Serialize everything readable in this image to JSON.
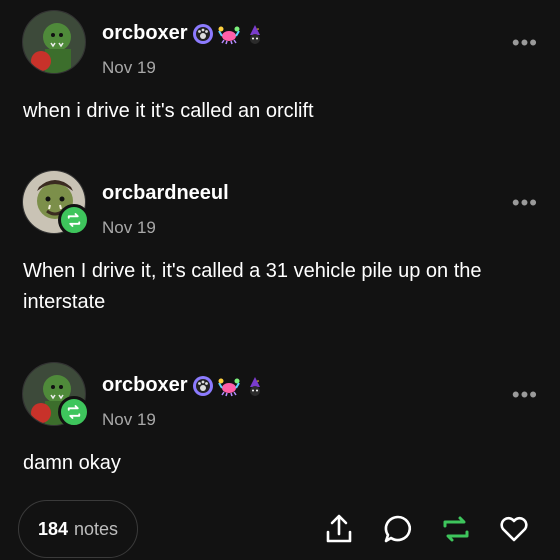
{
  "posts": [
    {
      "username": "orcboxer",
      "date": "Nov 19",
      "text": "when i drive it it's called an orclift",
      "badges": [
        "paw-icon",
        "crab-icon",
        "wizard-icon"
      ],
      "reblogged": false
    },
    {
      "username": "orcbardneeul",
      "date": "Nov 19",
      "text": "When I drive it, it's called a 31 vehicle pile up on the interstate",
      "badges": [],
      "reblogged": true
    },
    {
      "username": "orcboxer",
      "date": "Nov 19",
      "text": "damn okay",
      "badges": [
        "paw-icon",
        "crab-icon",
        "wizard-icon"
      ],
      "reblogged": true
    }
  ],
  "more_label": "•••",
  "footer": {
    "notes_count": "184",
    "notes_label": "notes",
    "actions": [
      "share-icon",
      "reply-icon",
      "reblog-icon",
      "like-icon"
    ]
  },
  "colors": {
    "background": "#121212",
    "reblog_green": "#3ec55c",
    "muted_text": "#a8a8a8"
  }
}
